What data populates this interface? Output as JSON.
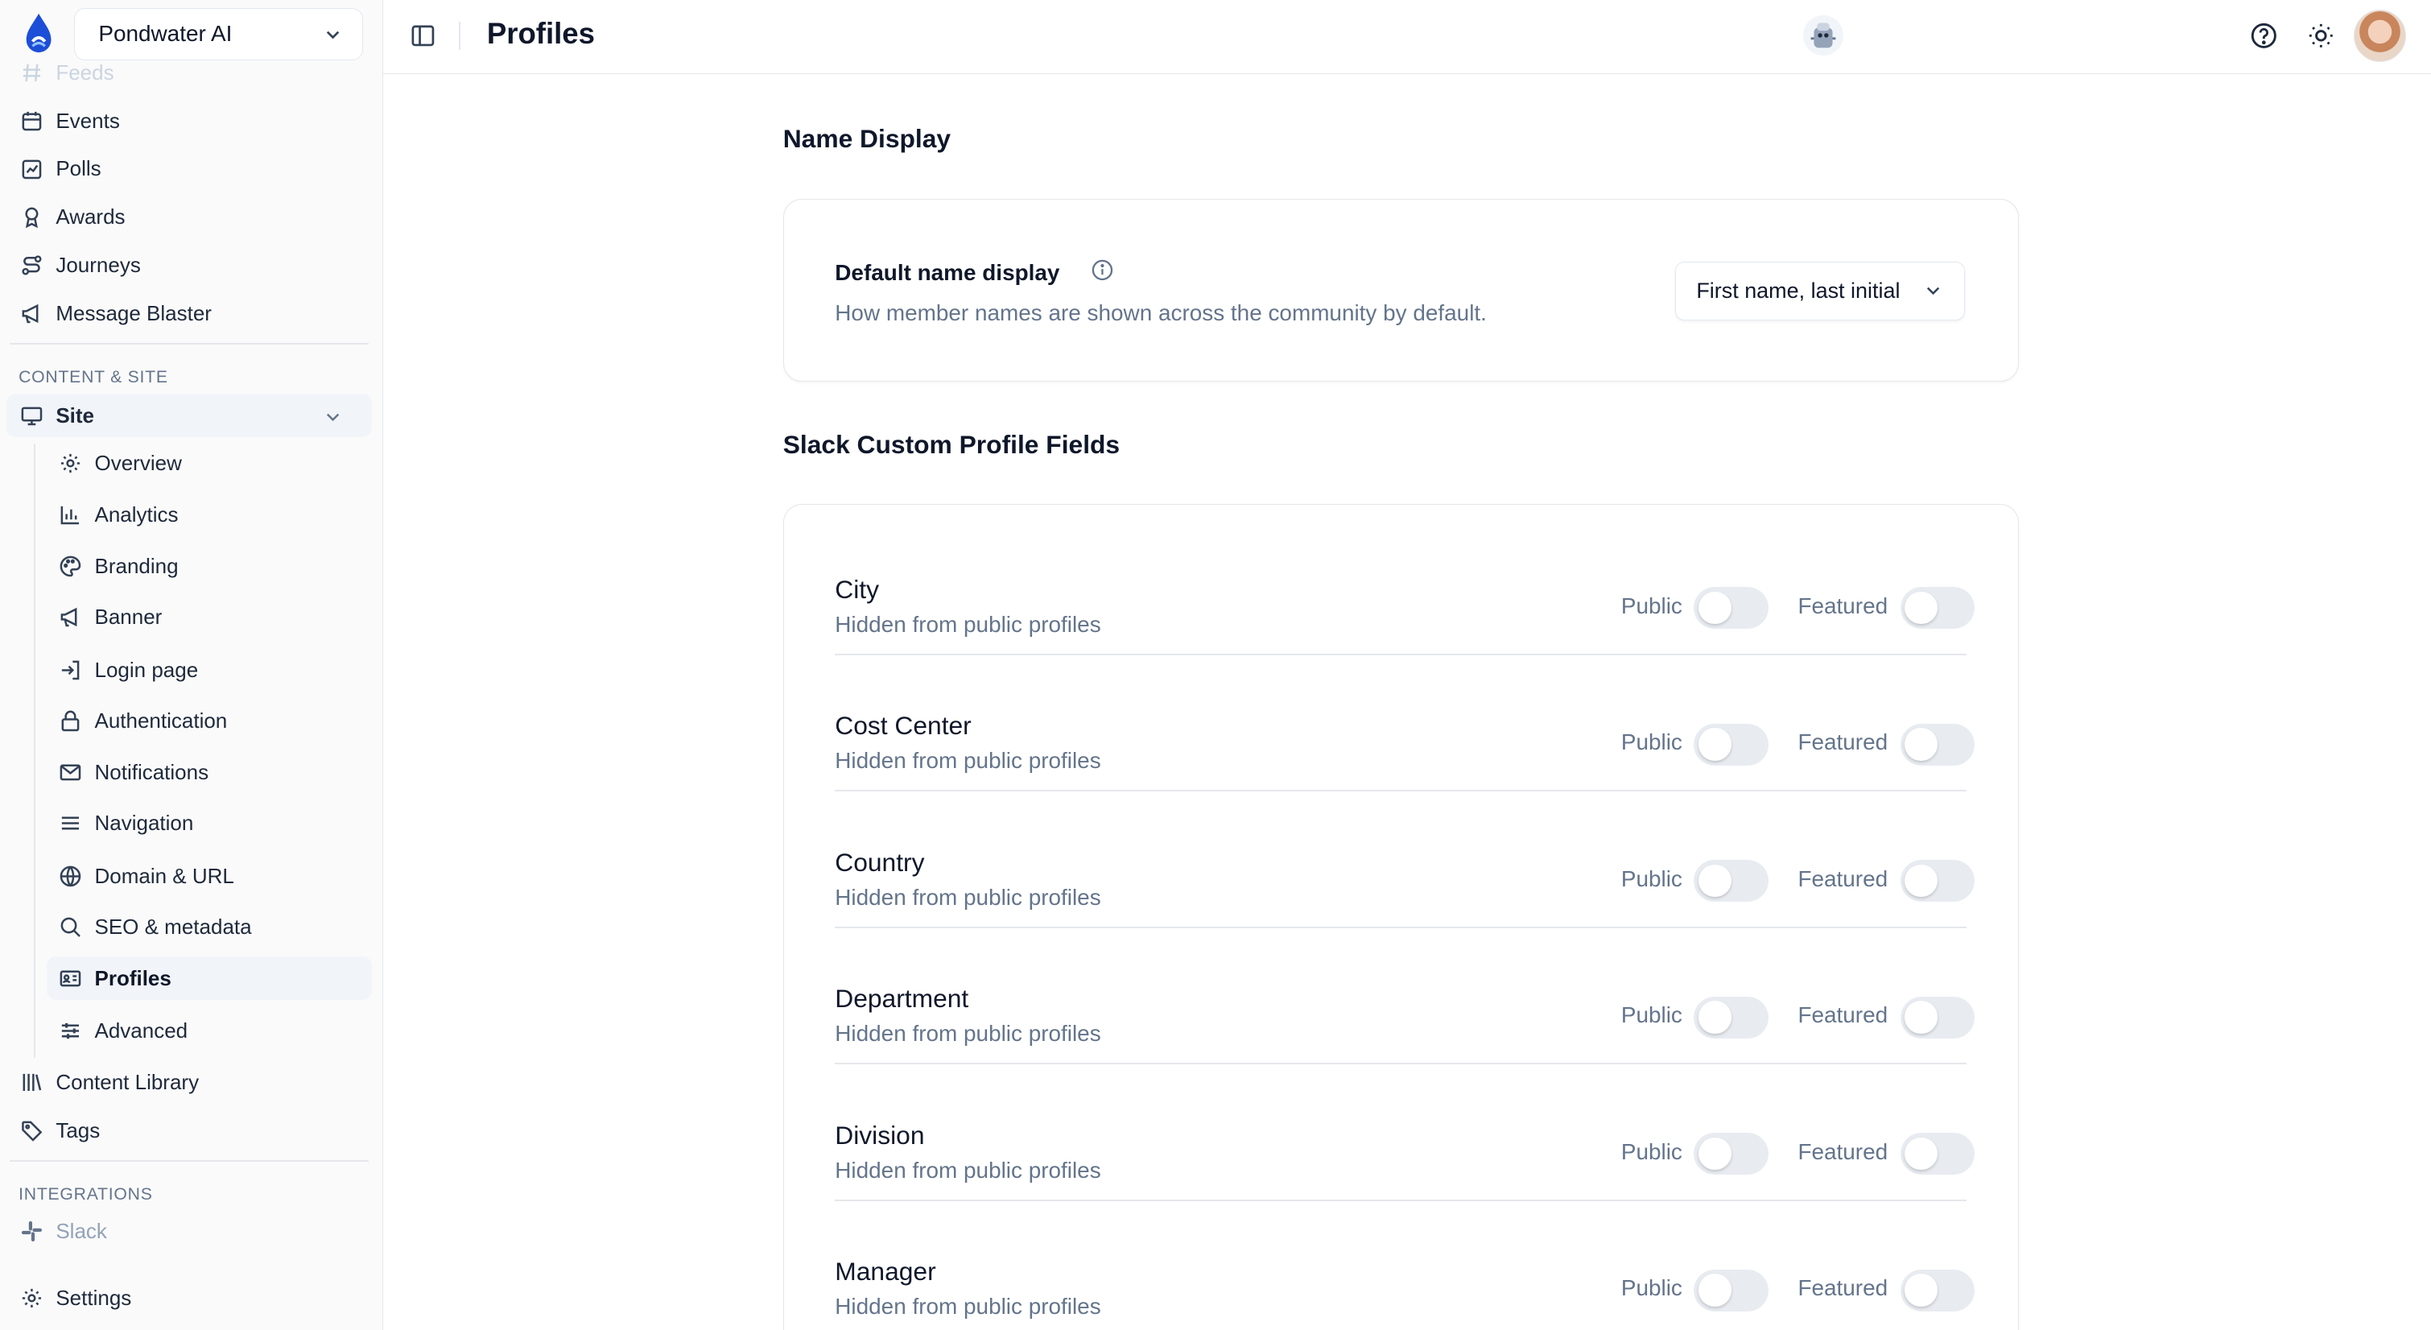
{
  "workspace": {
    "name": "Pondwater AI"
  },
  "sidebar": {
    "top_items": [
      {
        "label": "Feeds",
        "icon": "hash-icon"
      },
      {
        "label": "Events",
        "icon": "calendar-icon"
      },
      {
        "label": "Polls",
        "icon": "poll-icon"
      },
      {
        "label": "Awards",
        "icon": "award-icon"
      },
      {
        "label": "Journeys",
        "icon": "route-icon"
      },
      {
        "label": "Message Blaster",
        "icon": "megaphone-icon"
      }
    ],
    "content_section_label": "CONTENT & SITE",
    "site": {
      "label": "Site",
      "icon": "monitor-icon"
    },
    "site_children": [
      {
        "label": "Overview",
        "icon": "gear-icon"
      },
      {
        "label": "Analytics",
        "icon": "bar-chart-icon"
      },
      {
        "label": "Branding",
        "icon": "palette-icon"
      },
      {
        "label": "Banner",
        "icon": "megaphone-icon"
      },
      {
        "label": "Login page",
        "icon": "login-icon"
      },
      {
        "label": "Authentication",
        "icon": "lock-icon"
      },
      {
        "label": "Notifications",
        "icon": "mail-icon"
      },
      {
        "label": "Navigation",
        "icon": "menu-icon"
      },
      {
        "label": "Domain & URL",
        "icon": "globe-icon"
      },
      {
        "label": "SEO & metadata",
        "icon": "search-icon"
      },
      {
        "label": "Profiles",
        "icon": "id-card-icon",
        "active": true
      },
      {
        "label": "Advanced",
        "icon": "sliders-icon"
      }
    ],
    "after_items": [
      {
        "label": "Content Library",
        "icon": "library-icon"
      },
      {
        "label": "Tags",
        "icon": "tag-icon"
      }
    ],
    "integrations_label": "INTEGRATIONS",
    "integrations": [
      {
        "label": "Slack",
        "icon": "slack-icon"
      }
    ],
    "settings": {
      "label": "Settings",
      "icon": "gear-icon"
    }
  },
  "header": {
    "title": "Profiles"
  },
  "name_display": {
    "section_title": "Name Display",
    "label": "Default name display",
    "description": "How member names are shown across the community by default.",
    "selected": "First name, last initial"
  },
  "custom_fields": {
    "section_title": "Slack Custom Profile Fields",
    "public_label": "Public",
    "featured_label": "Featured",
    "fields": [
      {
        "name": "City",
        "description": "Hidden from public profiles",
        "public": false,
        "featured": false
      },
      {
        "name": "Cost Center",
        "description": "Hidden from public profiles",
        "public": false,
        "featured": false
      },
      {
        "name": "Country",
        "description": "Hidden from public profiles",
        "public": false,
        "featured": false
      },
      {
        "name": "Department",
        "description": "Hidden from public profiles",
        "public": false,
        "featured": false
      },
      {
        "name": "Division",
        "description": "Hidden from public profiles",
        "public": false,
        "featured": false
      },
      {
        "name": "Manager",
        "description": "Hidden from public profiles",
        "public": false,
        "featured": false
      }
    ]
  }
}
